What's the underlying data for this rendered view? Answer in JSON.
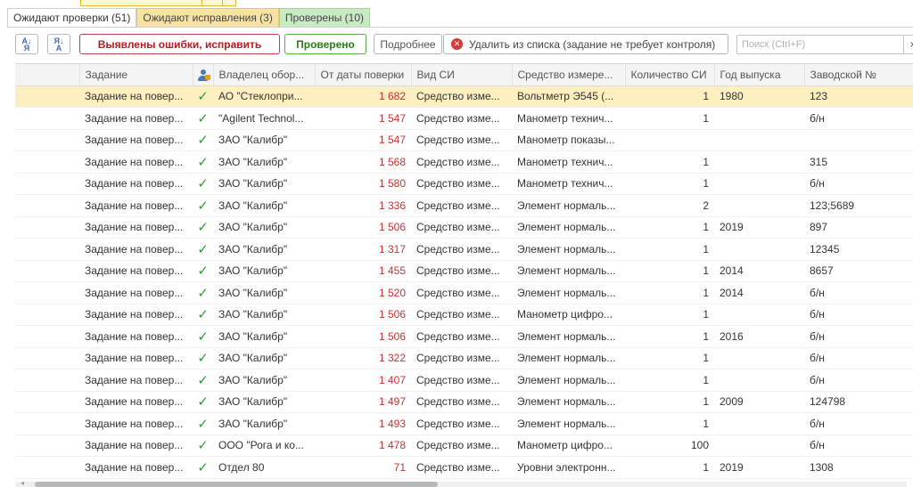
{
  "tabs": [
    {
      "label": "Ожидают проверки (51)"
    },
    {
      "label": "Ожидают исправления (3)"
    },
    {
      "label": "Проверены (10)"
    }
  ],
  "toolbar": {
    "sort_asc_icon": "sort-ascending-icon",
    "sort_desc_icon": "sort-descending-icon",
    "errors_label": "Выявлены ошибки, исправить",
    "verified_label": "Проверено",
    "more_label": "Подробнее",
    "remove_label": "Удалить из списка (задание не требует контроля)",
    "search_placeholder": "Поиск (Ctrl+F)",
    "clear_label": "×"
  },
  "colors": {
    "selected_row": "#fcefc0",
    "errors_button": "#b02020",
    "verified_button": "#2e7a20",
    "days_value": "#c83232",
    "check": "#2e9a3a"
  },
  "table": {
    "columns": [
      "Задание",
      "",
      "Владелец обор...",
      "От даты поверки",
      "Вид СИ",
      "Средство измере...",
      "Количество СИ",
      "Год выпуска",
      "Заводской №"
    ],
    "owner_column_icon": "person-icon",
    "rows": [
      {
        "task": "Задание на повер...",
        "owner": "АО \"Стеклопри...",
        "days": "1 682",
        "kind": "Средство изме...",
        "instrument": "Вольтметр Э545 (...",
        "qty": "1",
        "year": "1980",
        "serial": "123",
        "selected": true
      },
      {
        "task": "Задание на повер...",
        "owner": "\"Agilent Technol...",
        "days": "1 547",
        "kind": "Средство изме...",
        "instrument": "Манометр технич...",
        "qty": "1",
        "year": "",
        "serial": "б/н"
      },
      {
        "task": "Задание на повер...",
        "owner": "ЗАО \"Калибр\"",
        "days": "1 547",
        "kind": "Средство изме...",
        "instrument": "Манометр показы...",
        "qty": "",
        "year": "",
        "serial": ""
      },
      {
        "task": "Задание на повер...",
        "owner": "ЗАО \"Калибр\"",
        "days": "1 568",
        "kind": "Средство изме...",
        "instrument": "Манометр технич...",
        "qty": "1",
        "year": "",
        "serial": "315"
      },
      {
        "task": "Задание на повер...",
        "owner": "ЗАО \"Калибр\"",
        "days": "1 580",
        "kind": "Средство изме...",
        "instrument": "Манометр технич...",
        "qty": "1",
        "year": "",
        "serial": "б/н"
      },
      {
        "task": "Задание на повер...",
        "owner": "ЗАО \"Калибр\"",
        "days": "1 336",
        "kind": "Средство изме...",
        "instrument": "Элемент нормаль...",
        "qty": "2",
        "year": "",
        "serial": "123;5689"
      },
      {
        "task": "Задание на повер...",
        "owner": "ЗАО \"Калибр\"",
        "days": "1 506",
        "kind": "Средство изме...",
        "instrument": "Элемент нормаль...",
        "qty": "1",
        "year": "2019",
        "serial": "897"
      },
      {
        "task": "Задание на повер...",
        "owner": "ЗАО \"Калибр\"",
        "days": "1 317",
        "kind": "Средство изме...",
        "instrument": "Элемент нормаль...",
        "qty": "1",
        "year": "",
        "serial": "12345"
      },
      {
        "task": "Задание на повер...",
        "owner": "ЗАО \"Калибр\"",
        "days": "1 455",
        "kind": "Средство изме...",
        "instrument": "Элемент нормаль...",
        "qty": "1",
        "year": "2014",
        "serial": "8657"
      },
      {
        "task": "Задание на повер...",
        "owner": "ЗАО \"Калибр\"",
        "days": "1 520",
        "kind": "Средство изме...",
        "instrument": "Элемент нормаль...",
        "qty": "1",
        "year": "2014",
        "serial": "б/н"
      },
      {
        "task": "Задание на повер...",
        "owner": "ЗАО \"Калибр\"",
        "days": "1 506",
        "kind": "Средство изме...",
        "instrument": "Манометр цифро...",
        "qty": "1",
        "year": "",
        "serial": "б/н"
      },
      {
        "task": "Задание на повер...",
        "owner": "ЗАО \"Калибр\"",
        "days": "1 506",
        "kind": "Средство изме...",
        "instrument": "Элемент нормаль...",
        "qty": "1",
        "year": "2016",
        "serial": "б/н"
      },
      {
        "task": "Задание на повер...",
        "owner": "ЗАО \"Калибр\"",
        "days": "1 322",
        "kind": "Средство изме...",
        "instrument": "Элемент нормаль...",
        "qty": "1",
        "year": "",
        "serial": "б/н"
      },
      {
        "task": "Задание на повер...",
        "owner": "ЗАО \"Калибр\"",
        "days": "1 407",
        "kind": "Средство изме...",
        "instrument": "Элемент нормаль...",
        "qty": "1",
        "year": "",
        "serial": "б/н"
      },
      {
        "task": "Задание на повер...",
        "owner": "ЗАО \"Калибр\"",
        "days": "1 497",
        "kind": "Средство изме...",
        "instrument": "Элемент нормаль...",
        "qty": "1",
        "year": "2009",
        "serial": "124798"
      },
      {
        "task": "Задание на повер...",
        "owner": "ЗАО \"Калибр\"",
        "days": "1 493",
        "kind": "Средство изме...",
        "instrument": "Элемент нормаль...",
        "qty": "1",
        "year": "",
        "serial": "б/н"
      },
      {
        "task": "Задание на повер...",
        "owner": "ООО \"Рога и ко...",
        "days": "1 478",
        "kind": "Средство изме...",
        "instrument": "Манометр цифро...",
        "qty": "100",
        "year": "",
        "serial": "б/н"
      },
      {
        "task": "Задание на повер...",
        "owner": "Отдел 80",
        "days": "71",
        "kind": "Средство изме...",
        "instrument": "Уровни электронн...",
        "qty": "1",
        "year": "2019",
        "serial": "1308"
      }
    ]
  }
}
